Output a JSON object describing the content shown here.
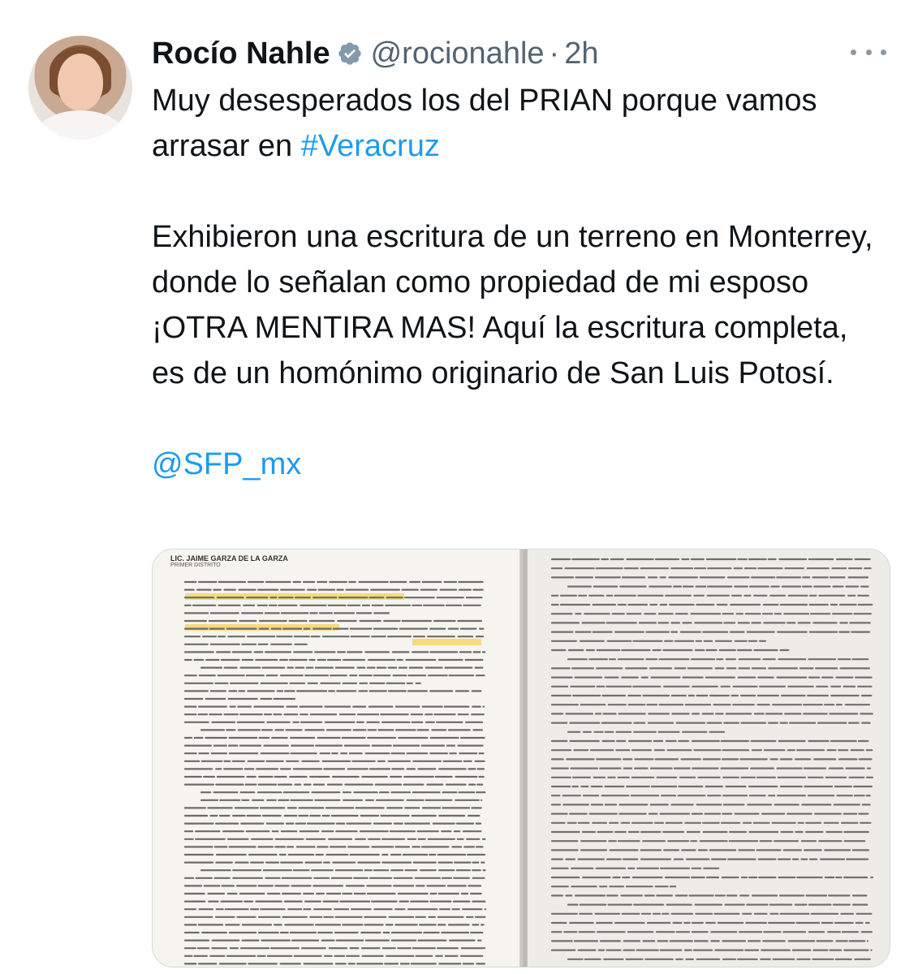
{
  "tweet": {
    "author_name": "Rocío Nahle",
    "handle": "@rocionahle",
    "separator": "·",
    "time": "2h",
    "line1_prefix": "Muy desesperados los del PRIAN porque vamos arrasar en ",
    "hashtag": "#Veracruz",
    "paragraph2": "Exhibieron una escritura de un terreno en Monterrey, donde lo señalan como propiedad de mi esposo ¡OTRA MENTIRA MAS! Aquí la escritura completa, es de un homónimo originario de San Luis Potosí.",
    "mention": "@SFP_mx"
  },
  "media": {
    "header_title": "LIC. JAIME GARZA DE LA GARZA",
    "header_subtitle": "PRIMER DISTRITO"
  },
  "icons": {
    "verified": "verified-badge-icon",
    "more": "more-options-icon"
  },
  "colors": {
    "link": "#1d9bf0",
    "secondary_text": "#536471",
    "highlight": "#f4d56a"
  }
}
